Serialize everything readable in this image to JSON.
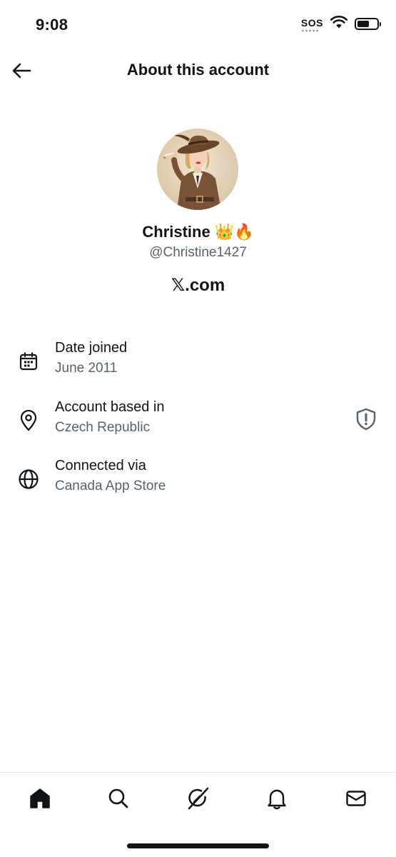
{
  "status_bar": {
    "time": "9:08",
    "sos": "SOS"
  },
  "header": {
    "title": "About this account",
    "back_icon": "arrow-left-icon"
  },
  "profile": {
    "display_name": "Christine 👑🔥",
    "handle": "@Christine1427",
    "platform_mark": "𝕏",
    "platform_suffix": ".com"
  },
  "info": [
    {
      "icon": "calendar-icon",
      "label": "Date joined",
      "value": "June 2011"
    },
    {
      "icon": "location-pin-icon",
      "label": "Account based in",
      "value": "Czech Republic",
      "badge_icon": "shield-alert-icon"
    },
    {
      "icon": "globe-icon",
      "label": "Connected via",
      "value": "Canada App Store"
    }
  ],
  "tab_bar": {
    "tabs": [
      "home-icon",
      "search-icon",
      "grok-icon",
      "notifications-bell-icon",
      "messages-envelope-icon"
    ],
    "active": "home-icon"
  },
  "colors": {
    "text_primary": "#0f1419",
    "text_secondary": "#536471",
    "divider": "#e1e5e8",
    "background": "#ffffff"
  }
}
